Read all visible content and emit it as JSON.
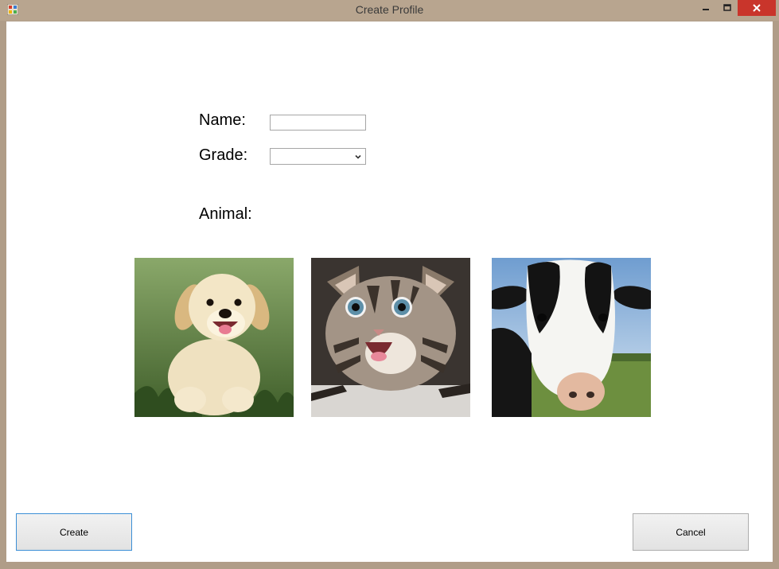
{
  "window": {
    "title": "Create Profile"
  },
  "form": {
    "name_label": "Name:",
    "name_value": "",
    "grade_label": "Grade:",
    "grade_value": "",
    "animal_label": "Animal:"
  },
  "animals": [
    {
      "icon": "puppy-picture"
    },
    {
      "icon": "kitten-picture"
    },
    {
      "icon": "cow-picture"
    }
  ],
  "buttons": {
    "create_label": "Create",
    "cancel_label": "Cancel"
  },
  "colors": {
    "close_button": "#c9352b",
    "focus_border": "#3c8fd6"
  }
}
